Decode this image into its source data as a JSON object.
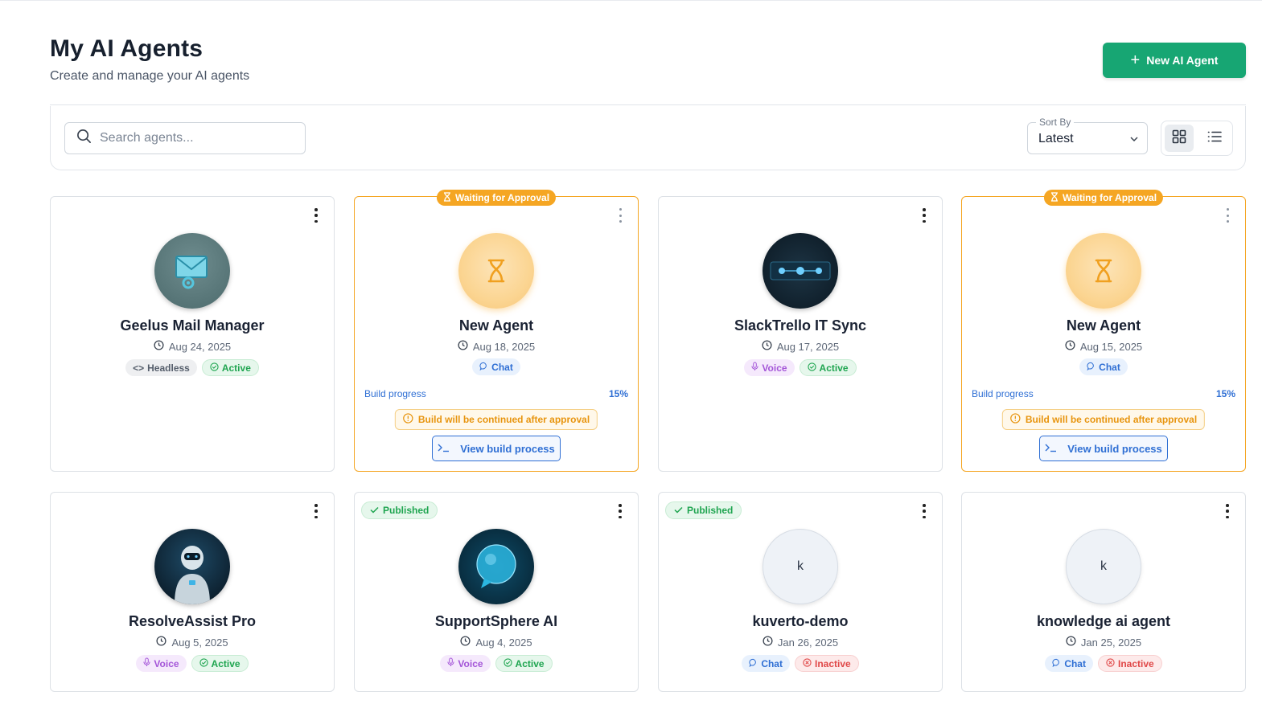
{
  "header": {
    "title": "My AI Agents",
    "subtitle": "Create and manage your AI agents",
    "new_button_label": "New AI Agent"
  },
  "toolbar": {
    "search_placeholder": "Search agents...",
    "sort_label": "Sort By",
    "sort_value": "Latest",
    "view_modes": [
      "grid",
      "list"
    ],
    "active_view": "grid"
  },
  "colors": {
    "primary_green": "#17a673",
    "pending_orange": "#f5a623",
    "chat_blue": "#2f6fd4",
    "voice_purple": "#a455d8",
    "active_green": "#1fa550",
    "inactive_red": "#e04848"
  },
  "cards": [
    {
      "name": "Geelus Mail Manager",
      "date": "Aug 24, 2025",
      "avatar": "mail-gear-icon",
      "badges": [
        {
          "label": "Headless",
          "kind": "headless"
        },
        {
          "label": "Active",
          "kind": "active"
        }
      ]
    },
    {
      "name": "New Agent",
      "date": "Aug 18, 2025",
      "avatar": "hourglass-icon",
      "top_badge": "Waiting for Approval",
      "badges": [
        {
          "label": "Chat",
          "kind": "chat"
        }
      ],
      "build_progress_label": "Build progress",
      "build_progress_pct": "15%",
      "approval_note": "Build will be continued after approval",
      "view_build_label": "View build process"
    },
    {
      "name": "SlackTrello IT Sync",
      "date": "Aug 17, 2025",
      "avatar": "sync-nodes-icon",
      "badges": [
        {
          "label": "Voice",
          "kind": "voice"
        },
        {
          "label": "Active",
          "kind": "active"
        }
      ]
    },
    {
      "name": "New Agent",
      "date": "Aug 15, 2025",
      "avatar": "hourglass-icon",
      "top_badge": "Waiting for Approval",
      "badges": [
        {
          "label": "Chat",
          "kind": "chat"
        }
      ],
      "build_progress_label": "Build progress",
      "build_progress_pct": "15%",
      "approval_note": "Build will be continued after approval",
      "view_build_label": "View build process"
    },
    {
      "name": "ResolveAssist Pro",
      "date": "Aug 5, 2025",
      "avatar": "robot-icon",
      "badges": [
        {
          "label": "Voice",
          "kind": "voice"
        },
        {
          "label": "Active",
          "kind": "active"
        }
      ]
    },
    {
      "name": "SupportSphere AI",
      "date": "Aug 4, 2025",
      "avatar": "chat-sphere-icon",
      "published_badge": "Published",
      "badges": [
        {
          "label": "Voice",
          "kind": "voice"
        },
        {
          "label": "Active",
          "kind": "active"
        }
      ]
    },
    {
      "name": "kuverto-demo",
      "date": "Jan 26, 2025",
      "avatar_letter": "k",
      "published_badge": "Published",
      "badges": [
        {
          "label": "Chat",
          "kind": "chat"
        },
        {
          "label": "Inactive",
          "kind": "inactive"
        }
      ]
    },
    {
      "name": "knowledge ai agent",
      "date": "Jan 25, 2025",
      "avatar_letter": "k",
      "badges": [
        {
          "label": "Chat",
          "kind": "chat"
        },
        {
          "label": "Inactive",
          "kind": "inactive"
        }
      ]
    }
  ]
}
